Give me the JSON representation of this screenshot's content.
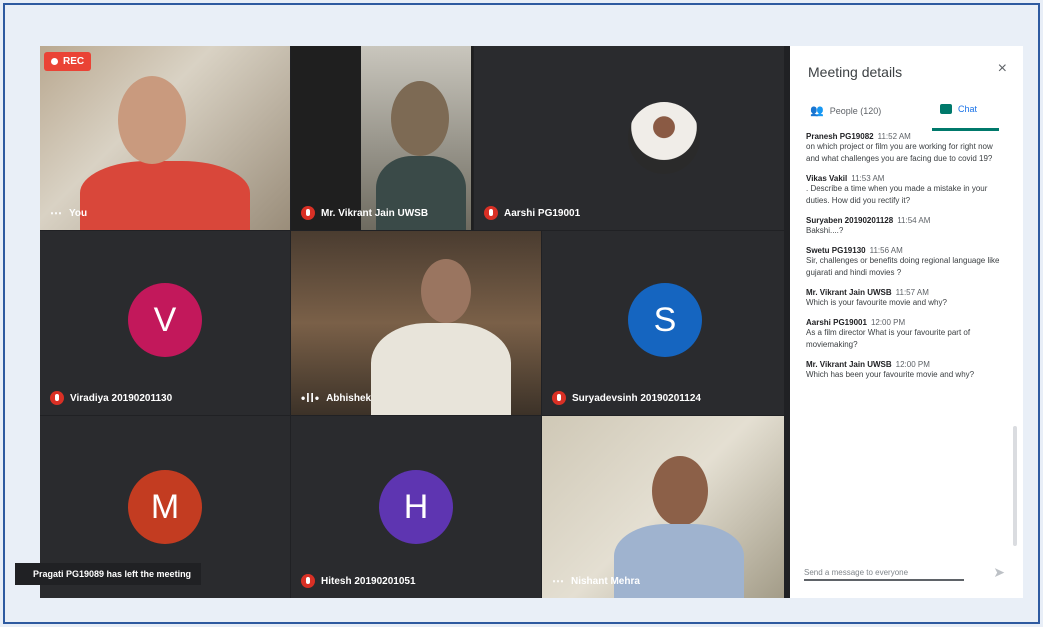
{
  "rec_label": "REC",
  "tiles": {
    "you": "You",
    "vikrant": "Mr. Vikrant Jain UWSB",
    "aarshi": "Aarshi PG19001",
    "viradiya": "Viradiya 20190201130",
    "abhishek": "Abhishek",
    "suryadev": "Suryadevsinh 20190201124",
    "pragati_avatar": "M",
    "hitesh": "Hitesh 20190201051",
    "nishant": "Nishant Mehra",
    "v_avatar": "V",
    "s_avatar": "S",
    "h_avatar": "H"
  },
  "toast": "Pragati PG19089 has left the meeting",
  "panel": {
    "title": "Meeting details",
    "close": "×",
    "people_tab": "People (120)",
    "chat_tab": "Chat",
    "input_placeholder": "Send a message to everyone",
    "messages": [
      {
        "sender": "Pranesh PG19082",
        "time": "11:52 AM",
        "text": "on which project or film you are working for right now and what challenges you are facing due to covid 19?"
      },
      {
        "sender": "Vikas Vakil",
        "time": "11:53 AM",
        "text": ". Describe a time when you made a mistake in your duties. How did you rectify it?"
      },
      {
        "sender": "Suryaben 20190201128",
        "time": "11:54 AM",
        "text": "Bakshi....?"
      },
      {
        "sender": "Swetu PG19130",
        "time": "11:56 AM",
        "text": "Sir, challenges or benefits doing regional language like gujarati and hindi movies ?"
      },
      {
        "sender": "Mr. Vikrant Jain UWSB",
        "time": "11:57 AM",
        "text": "Which is your favourite movie and why?"
      },
      {
        "sender": "Aarshi PG19001",
        "time": "12:00 PM",
        "text": "As a film director What is your favourite part of moviemaking?"
      },
      {
        "sender": "Mr. Vikrant Jain UWSB",
        "time": "12:00 PM",
        "text": "Which has been your favourite movie and why?"
      }
    ]
  },
  "colors": {
    "accent": "#1a73e8",
    "mic_off": "#d93025",
    "avatar_v": "#c2185b",
    "avatar_s": "#1565c0",
    "avatar_m": "#c33c21",
    "avatar_h": "#5e35b1"
  }
}
